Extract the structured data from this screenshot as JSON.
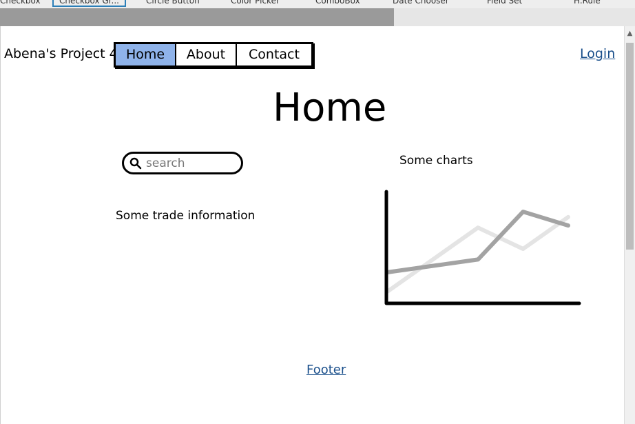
{
  "palette": {
    "items": [
      "Checkbox",
      "Checkbox Gr...",
      "Circle Button",
      "Color Picker",
      "ComboBox",
      "Date Chooser",
      "Field Set",
      "H.Rule"
    ],
    "selected_index": 1
  },
  "progress": {
    "fraction": 0.62
  },
  "nav": {
    "brand": "Abena's Project 4",
    "tabs": [
      {
        "label": "Home",
        "active": true
      },
      {
        "label": "About",
        "active": false
      },
      {
        "label": "Contact",
        "active": false
      }
    ],
    "login": "Login"
  },
  "main": {
    "title": "Home",
    "search_placeholder": "search",
    "trade_info": "Some trade information",
    "charts_label": "Some charts"
  },
  "chart_data": {
    "type": "line",
    "x": [
      0,
      1,
      2,
      3,
      4
    ],
    "series": [
      {
        "values": [
          0.1,
          null,
          0.7,
          0.5,
          0.8
        ],
        "color": "#e4e4e4"
      },
      {
        "values": [
          0.28,
          null,
          0.4,
          0.85,
          0.72
        ],
        "color": "#a3a3a3"
      }
    ],
    "xlim": [
      0,
      4
    ],
    "ylim": [
      0,
      1
    ],
    "axis_color": "#000000"
  },
  "footer": {
    "label": "Footer"
  },
  "icons": {
    "search": "search-icon",
    "scroll_up": "chevron-up-icon"
  }
}
